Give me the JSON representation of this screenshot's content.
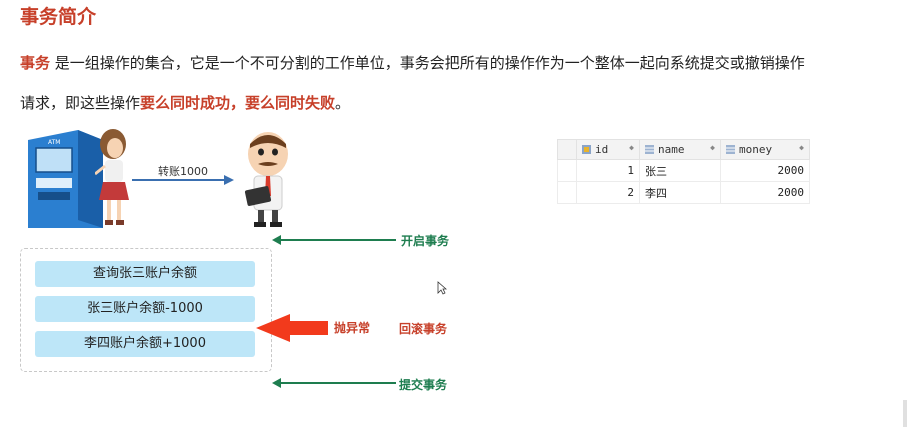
{
  "title": "事务简介",
  "paragraph": {
    "l1_highlight": "事务",
    "l1_text": " 是一组操作的集合，它是一个不可分割的工作单位，事务会把所有的操作作为一个整体一起向系统提交或撤销操作",
    "l2_text": "请求，即这些操作",
    "l2_highlight": "要么同时成功，要么同时失败",
    "l2_end": "。"
  },
  "diagram": {
    "transfer_label": "转账1000",
    "steps": [
      "查询张三账户余额",
      "张三账户余额-1000",
      "李四账户余额+1000"
    ],
    "open_tx": "开启事务",
    "exception": "抛异常",
    "rollback": "回滚事务",
    "commit": "提交事务",
    "colors": {
      "green": "#1e7d4f",
      "red": "#c7402a",
      "arrow_red": "#f23a1c",
      "step_bg": "#bde6f8"
    }
  },
  "db_table": {
    "columns": [
      "id",
      "name",
      "money"
    ],
    "rows": [
      {
        "rowno": "",
        "id": "1",
        "name": "张三",
        "money": "2000"
      },
      {
        "rowno": "",
        "id": "2",
        "name": "李四",
        "money": "2000"
      }
    ]
  },
  "icons": [
    "atm-machine",
    "person",
    "boss-with-tablet",
    "cursor-arrow",
    "key-column-icon",
    "column-icon",
    "sort-icon"
  ]
}
